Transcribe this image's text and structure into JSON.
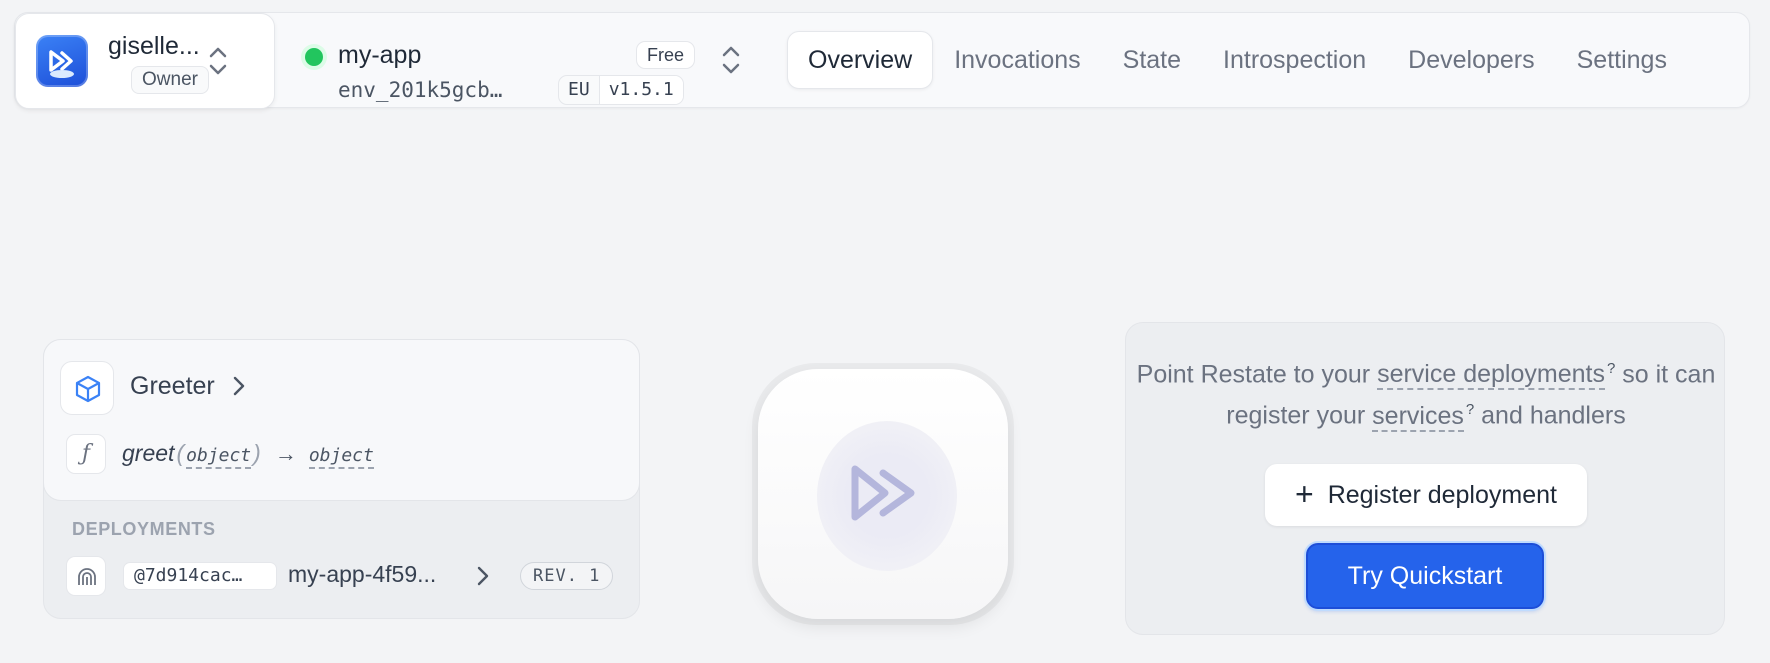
{
  "account": {
    "name": "giselle...",
    "role": "Owner"
  },
  "environment": {
    "name": "my-app",
    "id": "env_201k5gcb…",
    "plan": "Free",
    "region": "EU",
    "version": "v1.5.1",
    "status_color": "#22c55e"
  },
  "tabs": [
    {
      "label": "Overview",
      "active": true
    },
    {
      "label": "Invocations",
      "active": false
    },
    {
      "label": "State",
      "active": false
    },
    {
      "label": "Introspection",
      "active": false
    },
    {
      "label": "Developers",
      "active": false
    },
    {
      "label": "Settings",
      "active": false
    }
  ],
  "service": {
    "name": "Greeter",
    "handler": {
      "name": "greet",
      "input_type": "object",
      "output_type": "object",
      "arrow": "→"
    },
    "deployments_label": "DEPLOYMENTS",
    "deployment": {
      "id": "@7d914cac…",
      "name": "my-app-4f59...",
      "revision": "REV. 1"
    }
  },
  "info": {
    "text_1": "Point Restate to your",
    "link_1": "service deployments",
    "text_2": "so it can register your",
    "link_2": "services",
    "text_3": "and handlers",
    "tooltip_mark": "?",
    "register_label": "Register deployment",
    "quickstart_label": "Try Quickstart"
  },
  "colors": {
    "accent": "#2563eb",
    "background": "#f3f4f6"
  }
}
